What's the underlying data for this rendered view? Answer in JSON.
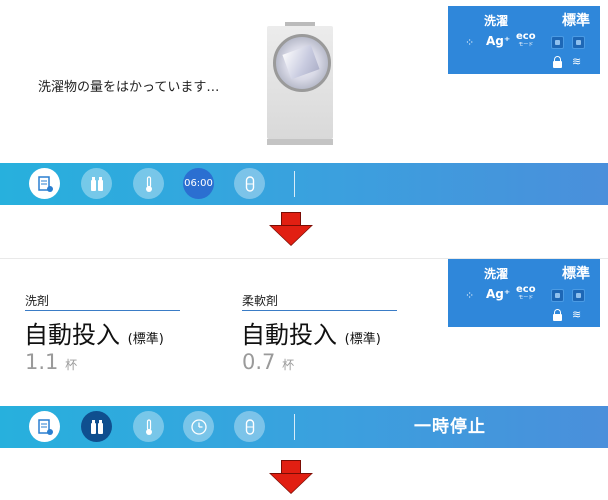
{
  "status_panel": {
    "left_title": "洗濯",
    "right_title": "標準",
    "icons": [
      "sparkle-icon",
      "ag-plus-icon",
      "eco-mode-icon",
      "square-icon-1",
      "square-icon-2",
      "lock-icon",
      "wifi-icon"
    ],
    "ag_text": "Ag⁺",
    "eco_text": "eco",
    "eco_sub": "モード",
    "color": "#2f87da"
  },
  "screen1": {
    "message": "洗濯物の量をはかっています…",
    "time_display": "06:00"
  },
  "screen2": {
    "detergent_label": "洗剤",
    "detergent_mode": "自動投入",
    "detergent_mode_sub": "(標準)",
    "detergent_amount": "1.1",
    "detergent_unit": "杯",
    "softener_label": "柔軟剤",
    "softener_mode": "自動投入",
    "softener_mode_sub": "(標準)",
    "softener_amount": "0.7",
    "softener_unit": "杯",
    "pause_button": "一時停止"
  },
  "bar_icons": [
    "settings-doc-icon",
    "detergent-bottles-icon",
    "thermometer-icon",
    "clock-icon",
    "capsule-icon"
  ],
  "colors": {
    "bar_start": "#27b0dd",
    "bar_end": "#4a8fdb",
    "arrow": "#e11f12",
    "underline": "#3a7cc6"
  }
}
